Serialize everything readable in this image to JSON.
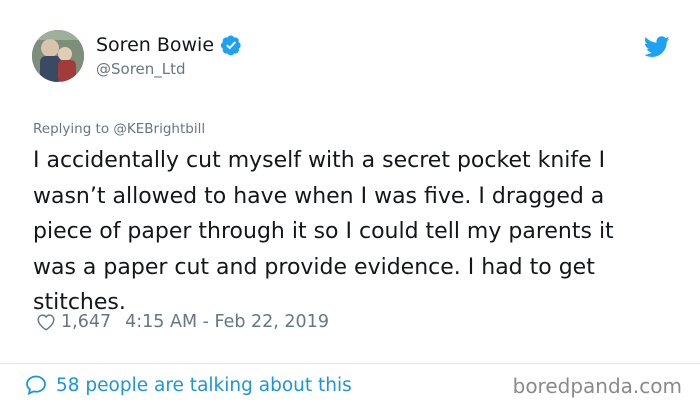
{
  "tweet": {
    "author_name": "Soren Bowie",
    "handle": "@Soren_Ltd",
    "replying_to": "Replying to @KEBrightbill",
    "text": "I accidentally cut myself with a secret pocket knife I\nwasn’t allowed to have when I was five. I dragged a\npiece of paper through it so I could tell my parents it\nwas a paper cut and provide evidence. I had to get\nstitches.",
    "likes": "1,647",
    "timestamp": "4:15 AM - Feb 22, 2019",
    "conversation_text": "58 people are talking about this"
  },
  "watermark": "boredpanda.com",
  "icons": {
    "verified": "verified-badge-icon",
    "twitter": "twitter-bird-icon",
    "like": "heart-icon",
    "reply": "speech-bubble-icon"
  },
  "colors": {
    "accent": "#1da1f2",
    "link": "#1b95e0",
    "muted": "#657786",
    "text": "#14171a"
  }
}
